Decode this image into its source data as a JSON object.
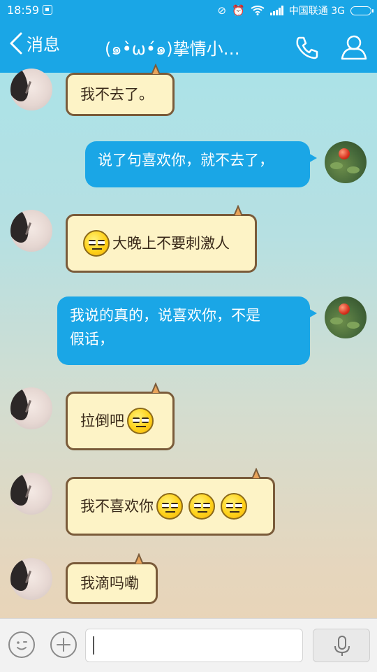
{
  "status_bar": {
    "time": "18:59",
    "carrier": "中国联通 3G"
  },
  "header": {
    "back_label": "消息",
    "title": "(๑•̀ω•́๑)挚情小…"
  },
  "messages": [
    {
      "side": "left",
      "text": "我不去了。"
    },
    {
      "side": "right",
      "text": "说了句喜欢你，就不去了，"
    },
    {
      "side": "left",
      "text": "大晚上不要刺激人",
      "emoji_before": 1
    },
    {
      "side": "right",
      "line1": "我说的真的，说喜欢你，不是",
      "line2": "假话，"
    },
    {
      "side": "left",
      "text": "拉倒吧",
      "emoji_after": 1
    },
    {
      "side": "left",
      "text": "我不喜欢你",
      "emoji_after": 3
    },
    {
      "side": "left",
      "text": "我滴吗嘞"
    }
  ],
  "colors": {
    "accent": "#1aa6e6",
    "bubble_fill": "#fdf3c6",
    "bubble_border": "#7a5b3a"
  },
  "icons": {
    "back": "chevron-left-icon",
    "call": "phone-icon",
    "profile": "person-icon",
    "emoji": "smiley-icon",
    "add": "plus-icon",
    "voice": "microphone-icon"
  }
}
